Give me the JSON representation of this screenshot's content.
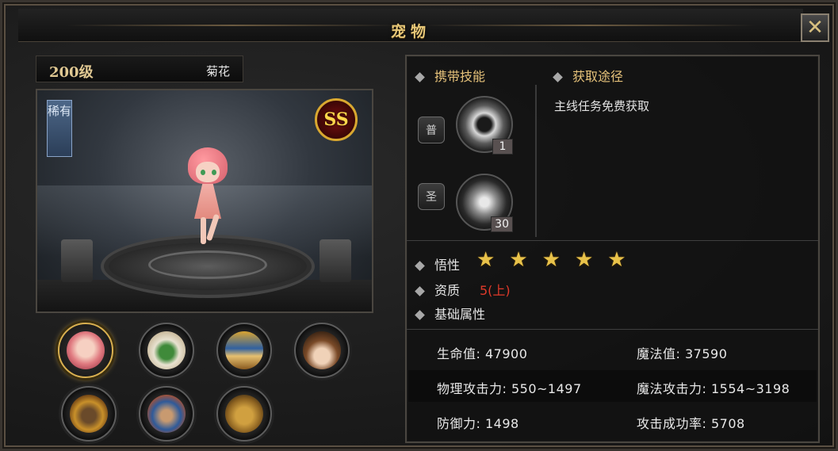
{
  "window": {
    "title": "宠物",
    "close_label": "✕"
  },
  "pet": {
    "level": "200级",
    "name": "菊花",
    "rarity": "稀有",
    "grade": "SS"
  },
  "pet_list": [
    {
      "name": "pink-girl-pet",
      "active": true
    },
    {
      "name": "clown-pet",
      "active": false
    },
    {
      "name": "pharaoh-pet",
      "active": false
    },
    {
      "name": "witch-pet",
      "active": false
    },
    {
      "name": "helmet-warrior-pet",
      "active": false
    },
    {
      "name": "oni-mask-pet",
      "active": false
    },
    {
      "name": "horned-ogre-pet",
      "active": false
    }
  ],
  "skills": {
    "header": "携带技能",
    "items": [
      {
        "type": "普",
        "level": "1",
        "icon": "swirl-icon"
      },
      {
        "type": "圣",
        "level": "30",
        "icon": "fist-icon"
      }
    ]
  },
  "obtain": {
    "header": "获取途径",
    "text": "主线任务免费获取"
  },
  "attributes": {
    "comprehension_label": "悟性",
    "stars": 5,
    "aptitude_label": "资质",
    "aptitude_value": "5(上)",
    "base_label": "基础属性"
  },
  "stats": {
    "hp": "生命值: 47900",
    "mp": "魔法值: 37590",
    "phys_atk": "物理攻击力: 550~1497",
    "mag_atk": "魔法攻击力: 1554~3198",
    "defense": "防御力: 1498",
    "hit_rate": "攻击成功率: 5708"
  },
  "colors": {
    "gold": "#e6c27a",
    "aptitude_red": "#e03a2a",
    "star": "#e8c24a"
  }
}
